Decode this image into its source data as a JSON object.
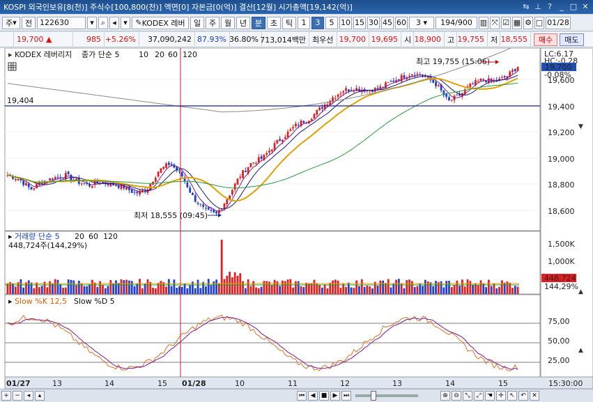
{
  "window": {
    "title": "KOSPI 외국인보유[8(천)] 주식수[100,800(천)] 액면[0] 자본금[0(억)] 결산[12월] 시가총액[19,142(억)]"
  },
  "toolbar": {
    "type_select": "주",
    "prev_label": "전",
    "code": "122630",
    "name_btn": "KODEX 레버",
    "period_buttons": [
      "일",
      "주",
      "월",
      "년",
      "분",
      "초",
      "틱"
    ],
    "selected_period": "분",
    "interval_buttons": [
      "1",
      "3",
      "5",
      "10",
      "15",
      "30",
      "45",
      "60"
    ],
    "selected_interval": "3",
    "interval_value": "3",
    "count_value": "194",
    "count_total": "/900",
    "date_value": "01/28"
  },
  "quote": {
    "price": "19,700",
    "change": "985",
    "change_pct": "+5.26%",
    "volume": "37,090,242",
    "ratio1": "87.93%",
    "ratio2": "36.80%",
    "amount": "713,014백만",
    "best_label": "최우선",
    "best_ask": "19,700",
    "best_bid": "19,695",
    "open_label": "시",
    "open": "18,900",
    "high_label": "고",
    "high": "19,755",
    "low_label": "저",
    "low": "18,555",
    "buy_label": "매수",
    "sell_label": "매도"
  },
  "price_panel": {
    "legend_name": "KODEX 레버리지",
    "legend_ma": "종가 단순 5",
    "legend_periods": [
      "10",
      "20",
      "60",
      "120"
    ],
    "hline_label": "19,404",
    "high_note": "최고 19,755 (15:06)",
    "low_note": "최저 18,555 (09:45)",
    "lc_label": "LC:6.17",
    "hc_label": "HC:-0.28",
    "last_price": "19,700",
    "last_pct": "-0.08%",
    "yticks": [
      "19,600",
      "19,400",
      "19,200",
      "19,000",
      "18,800",
      "18,600"
    ]
  },
  "volume_panel": {
    "legend": "거래량 단순 5",
    "legend_periods": [
      "20",
      "60",
      "120"
    ],
    "value_note": "448,724주(144,29%)",
    "last_value": "448,724",
    "last_pct": "144,29%",
    "yticks": [
      "1,500K",
      "1,000K"
    ]
  },
  "stoch_panel": {
    "legend_k": "Slow %K 12,5",
    "legend_d": "Slow %D 5",
    "yticks": [
      "75,00",
      "50,00",
      "25,00"
    ]
  },
  "xaxis": {
    "labels": [
      "01/27",
      "13",
      "14",
      "15",
      "01/28",
      "10",
      "11",
      "12",
      "13",
      "14",
      "15"
    ],
    "right_label": "15:30:00"
  },
  "colors": {
    "up": "#e02020",
    "down": "#1f3fd0",
    "ma5": "#7a1a90",
    "ma10": "#1a1a7a",
    "ma20": "#e0a000",
    "ma60": "#2a9a3a",
    "ma120": "#8a8a8a"
  },
  "chart_data": {
    "type": "candlestick",
    "x_sessions": [
      "01/27 13:00",
      "01/27 14:00",
      "01/27 15:00",
      "01/28 09:00",
      "01/28 10:00",
      "01/28 11:00",
      "01/28 12:00",
      "01/28 13:00",
      "01/28 14:00",
      "01/28 15:00"
    ],
    "close_path": [
      18870,
      18840,
      18760,
      18820,
      18850,
      18870,
      18820,
      18790,
      18820,
      18800,
      18780,
      18730,
      18760,
      18900,
      18960,
      18870,
      18700,
      18600,
      18570,
      18700,
      18860,
      18960,
      19000,
      19100,
      19180,
      19260,
      19300,
      19380,
      19460,
      19520,
      19530,
      19520,
      19530,
      19580,
      19620,
      19650,
      19620,
      19560,
      19430,
      19480,
      19560,
      19600,
      19580,
      19620,
      19700
    ],
    "hline": 19404,
    "high": 19755,
    "low": 18555,
    "ylim": [
      18500,
      19800
    ]
  }
}
